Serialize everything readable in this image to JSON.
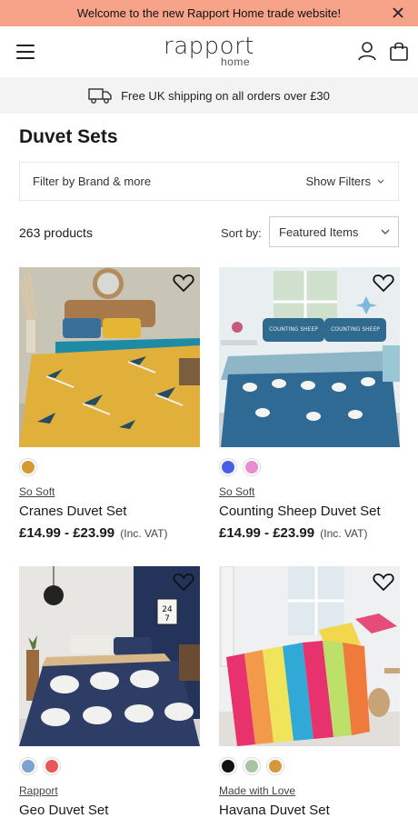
{
  "announcement": {
    "text": "Welcome to the new Rapport Home trade website!"
  },
  "header": {
    "logo_main": "rapport",
    "logo_sub": "home"
  },
  "shipping": {
    "text": "Free UK shipping on all orders over £30"
  },
  "page": {
    "title": "Duvet Sets",
    "product_count": "263 products"
  },
  "filters": {
    "left_label": "Filter by Brand & more",
    "right_label": "Show Filters"
  },
  "sort": {
    "label": "Sort by:",
    "selected": "Featured Items"
  },
  "products": [
    {
      "brand": "So Soft",
      "name": "Cranes Duvet Set",
      "price": "£14.99 - £23.99",
      "vat": "(Inc. VAT)",
      "swatches": [
        "#d49a32"
      ]
    },
    {
      "brand": "So Soft",
      "name": "Counting Sheep Duvet Set",
      "price": "£14.99 - £23.99",
      "vat": "(Inc. VAT)",
      "swatches": [
        "#4a5ee8",
        "#ea8ccd"
      ]
    },
    {
      "brand": "Rapport",
      "name": "Geo Duvet Set",
      "swatches": [
        "#7ea3cf",
        "#e85858"
      ]
    },
    {
      "brand": "Made with Love",
      "name": "Havana Duvet Set",
      "swatches": [
        "#111111",
        "#a8c4a0",
        "#d49a3a"
      ]
    }
  ],
  "colors": {
    "announcement_bg": "#f7a389",
    "shipping_bg": "#f3f3f3"
  },
  "icons": [
    "close-icon",
    "menu-icon",
    "account-icon",
    "bag-icon",
    "truck-icon",
    "chevron-down-icon",
    "heart-icon"
  ]
}
